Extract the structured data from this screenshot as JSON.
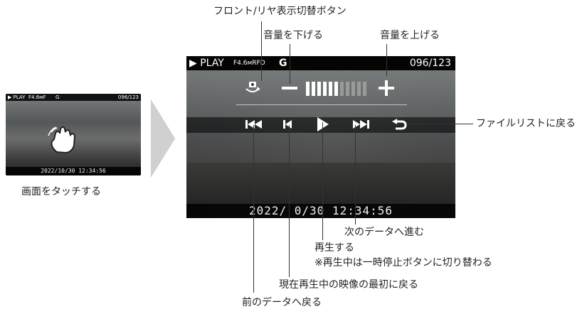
{
  "thumbnail": {
    "play_label": "▶ PLAY",
    "f_label": "F4.6мF",
    "g_label": "G",
    "counter": "096/123",
    "timestamp": "2022/10/30 12:34:56",
    "caption": "画面をタッチする"
  },
  "screen": {
    "play_label": "▶ PLAY",
    "f_label": "F4.6мRFD",
    "g_label": "G",
    "counter": "096/123",
    "timestamp": "2022/ 0/30 12:34:56",
    "volume_level": "6 of 11",
    "colors": {
      "volume_active": "#ffffff",
      "volume_inactive": "#9a9a9a",
      "icons": "#ffffff"
    }
  },
  "labels": {
    "front_rear_toggle": "フロント/リヤ表示切替ボタン",
    "volume_down": "音量を下げる",
    "volume_up": "音量を上げる",
    "file_list": "ファイルリストに戻る",
    "next_data": "次のデータへ進む",
    "play": "再生する",
    "play_note": "※再生中は一時停止ボタンに切り替わる",
    "restart": "現在再生中の映像の最初に戻る",
    "prev_data": "前のデータへ戻る"
  },
  "icons": [
    "camera-switch-icon",
    "minus-icon",
    "plus-icon",
    "skip-back-icon",
    "restart-icon",
    "play-icon",
    "skip-forward-icon",
    "return-icon",
    "hand-tap-icon",
    "chevron-right-icon"
  ]
}
